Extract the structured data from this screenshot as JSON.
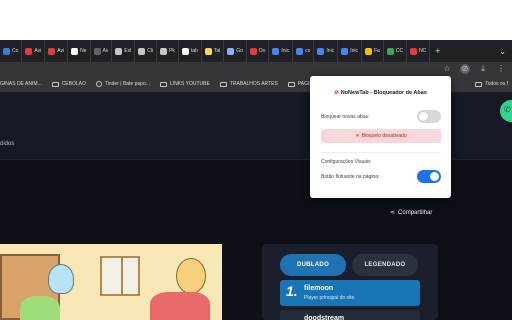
{
  "browser": {
    "tabs": [
      {
        "label": "Co",
        "color": "#3a7bd5"
      },
      {
        "label": "Avi",
        "color": "#e53935"
      },
      {
        "label": "Avi",
        "color": "#e53935"
      },
      {
        "label": "Ne",
        "color": "#ffffff"
      },
      {
        "label": "Av",
        "color": "#5f6368"
      },
      {
        "label": "Exl",
        "color": "#c4c7c5"
      },
      {
        "label": "Cli",
        "color": "#c4c7c5"
      },
      {
        "label": "Pk",
        "color": "#c4c7c5"
      },
      {
        "label": "tab",
        "color": "#ffffff"
      },
      {
        "label": "Tal",
        "color": "#ffd54f"
      },
      {
        "label": "Go",
        "color": "#8ab4f8"
      },
      {
        "label": "Do",
        "color": "#e53935"
      },
      {
        "label": "Inic",
        "color": "#4285f4"
      },
      {
        "label": "co",
        "color": "#4285f4"
      },
      {
        "label": "Inic",
        "color": "#4285f4"
      },
      {
        "label": "Inic",
        "color": "#4285f4"
      },
      {
        "label": "Fa",
        "color": "#fbbc04"
      },
      {
        "label": "CC",
        "color": "#34a853"
      },
      {
        "label": "NC",
        "color": "#e53935"
      }
    ],
    "new_tab": "+",
    "window_menu": "⌄",
    "bookmarks": [
      "GINAS DE ANIM...",
      "CEBOLAO",
      "Tinder | Bate papo...",
      "LINKS YOUTUBE",
      "TRABALHOS ARTES",
      "PAGINA DE FILMES"
    ],
    "bookmarks_right": "Todos os f"
  },
  "page": {
    "nav_fragment": "didos",
    "share": "Compartilhar",
    "lang_dubbed": "DUBLADO",
    "lang_subbed": "LEGENDADO",
    "servers": [
      {
        "num": "1.",
        "name": "filemoon",
        "desc": "Player principal do site."
      },
      {
        "num": "",
        "name": "doodstream",
        "desc": ""
      }
    ]
  },
  "popup": {
    "title": "NoNewTab - Bloqueador de Abas",
    "block_label": "Bloquear novas abas:",
    "block_enabled": false,
    "status": "Bloqueio desativado",
    "section": "Configurações Visuais",
    "floating_label": "Botão flutuante na página:",
    "floating_enabled": true
  },
  "colors": {
    "accent": "#1a73e8",
    "status_bg": "#f8d7da",
    "status_text": "#b3261e",
    "dub_button": "#1f73b5"
  }
}
